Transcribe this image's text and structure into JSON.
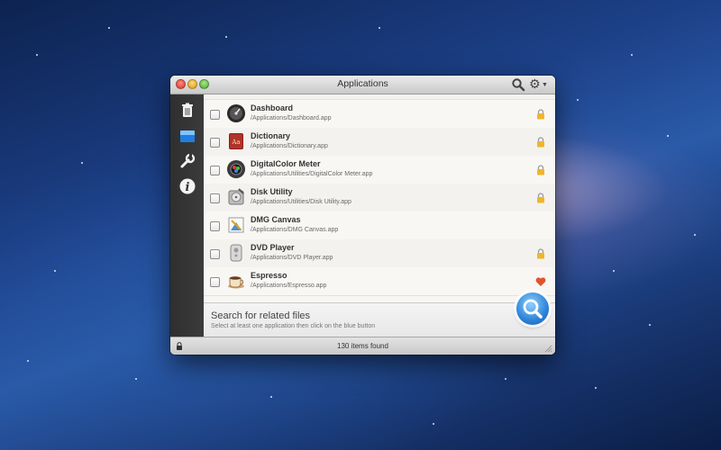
{
  "window": {
    "title": "Applications"
  },
  "sidebar": {
    "items": [
      {
        "name": "trash-icon"
      },
      {
        "name": "applications-drawer-icon"
      },
      {
        "name": "tools-icon"
      },
      {
        "name": "info-icon"
      }
    ]
  },
  "apps": [
    {
      "name": "Dashboard",
      "path": "/Applications/Dashboard.app",
      "badge": "lock"
    },
    {
      "name": "Dictionary",
      "path": "/Applications/Dictionary.app",
      "badge": "lock"
    },
    {
      "name": "DigitalColor Meter",
      "path": "/Applications/Utilities/DigitalColor Meter.app",
      "badge": "lock"
    },
    {
      "name": "Disk Utility",
      "path": "/Applications/Utilities/Disk Utility.app",
      "badge": "lock"
    },
    {
      "name": "DMG Canvas",
      "path": "/Applications/DMG Canvas.app",
      "badge": "none"
    },
    {
      "name": "DVD Player",
      "path": "/Applications/DVD Player.app",
      "badge": "lock"
    },
    {
      "name": "Espresso",
      "path": "/Applications/Espresso.app",
      "badge": "heart"
    }
  ],
  "search_panel": {
    "title": "Search for related files",
    "subtitle": "Select at least one application then click on the blue button"
  },
  "status": {
    "text": "130 items found"
  },
  "colors": {
    "accent": "#2c83d8",
    "lock": "#f0b52a",
    "heart": "#e0542b"
  }
}
